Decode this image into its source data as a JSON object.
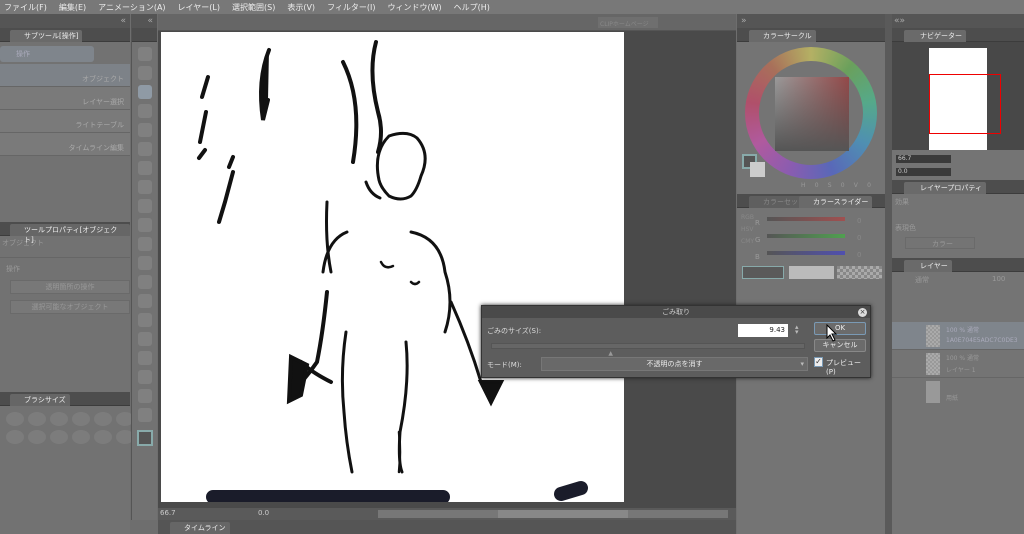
{
  "menu": [
    "ファイル(F)",
    "編集(E)",
    "アニメーション(A)",
    "レイヤー(L)",
    "選択範囲(S)",
    "表示(V)",
    "フィルター(I)",
    "ウィンドウ(W)",
    "ヘルプ(H)"
  ],
  "toolbar": {
    "clip_home": "CLIPホームページ"
  },
  "subtool": {
    "tab": "サブツール[操作]",
    "group": "操作",
    "items": [
      "オブジェクト",
      "レイヤー選択",
      "ライトテーブル",
      "タイムライン編集"
    ]
  },
  "toolprop": {
    "tab": "ツールプロパティ[オブジェクト]",
    "name": "オブジェクト",
    "section": "操作",
    "select1": "透明箇所の操作",
    "select2": "選択可能なオブジェクト"
  },
  "brushsize": {
    "tab": "ブラシサイズ"
  },
  "status": {
    "zoom": "66.7",
    "angle": "0.0"
  },
  "timeline": {
    "tab": "タイムライン"
  },
  "color_circle": {
    "tab": "カラーサークル",
    "h": "H",
    "s": "S",
    "v": "V",
    "h_val": "0",
    "s_val": "0",
    "v_val": "0"
  },
  "color_slider": {
    "tab_set": "カラーセット",
    "tab": "カラースライダー",
    "r": "R",
    "g": "G",
    "b": "B",
    "r_val": "0",
    "g_val": "0",
    "b_val": "0",
    "modes": [
      "RGB",
      "HSV",
      "CMY"
    ]
  },
  "navigator": {
    "tab": "ナビゲーター",
    "zoom": "66.7",
    "angle": "0.0"
  },
  "layer_prop": {
    "tab": "レイヤープロパティ",
    "effect": "効果",
    "express_color": "表現色",
    "color_mode": "カラー"
  },
  "layers": {
    "tab": "レイヤー",
    "blend": "通常",
    "opacity": "100",
    "items": [
      {
        "info": "100 % 通常",
        "name": "1A0E704E5ADC7C0DE3"
      },
      {
        "info": "100 % 通常",
        "name": "レイヤー 1"
      },
      {
        "info": "",
        "name": "用紙"
      }
    ]
  },
  "dialog": {
    "title": "ごみ取り",
    "size_label": "ごみのサイズ(S):",
    "size_value": "9.43",
    "mode_label": "モード(M):",
    "mode_value": "不透明の点を消す",
    "ok": "OK",
    "cancel": "キャンセル",
    "preview": "プレビュー(P)",
    "preview_checked": true,
    "slider_fraction": 0.38
  }
}
